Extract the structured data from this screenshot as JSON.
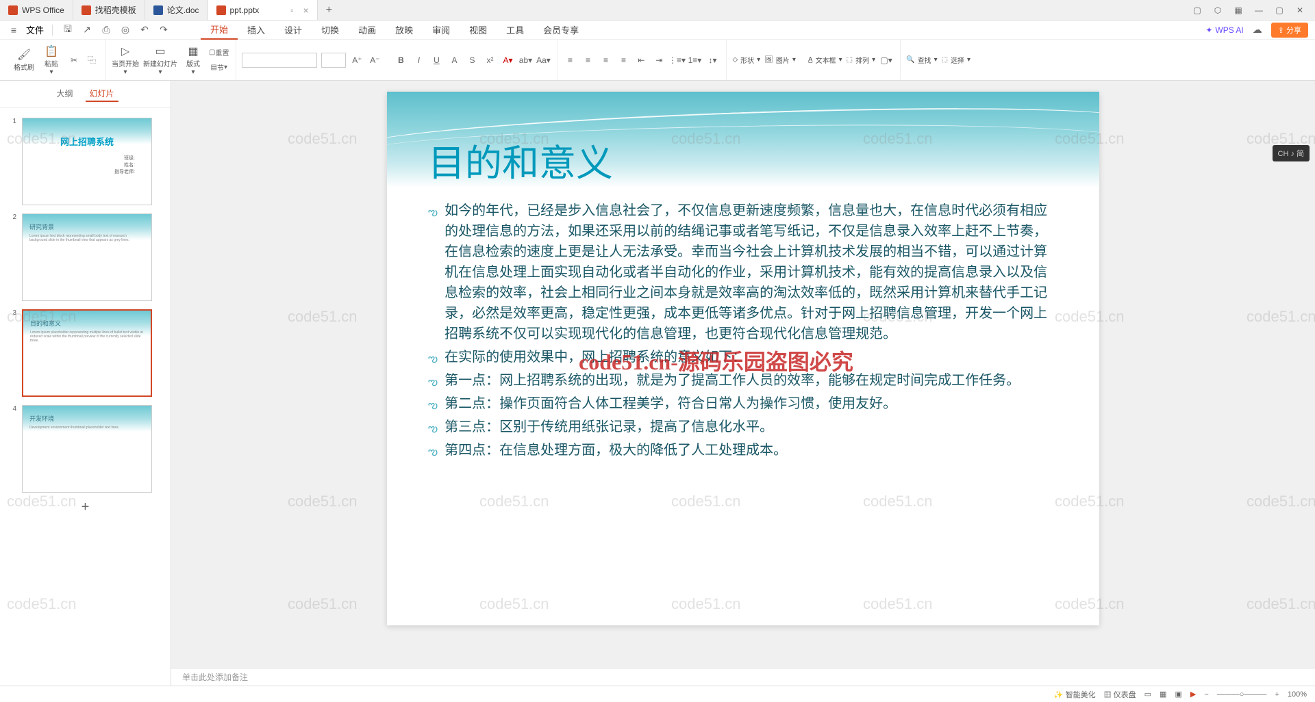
{
  "app": {
    "name": "WPS Office"
  },
  "tabs": [
    {
      "label": "WPS Office",
      "icon": "wps"
    },
    {
      "label": "找稻壳模板",
      "icon": "red"
    },
    {
      "label": "论文.doc",
      "icon": "blue"
    },
    {
      "label": "ppt.pptx",
      "icon": "orange",
      "active": true
    }
  ],
  "tab_add": "+",
  "menubar": {
    "file": "文件",
    "tabs": [
      "开始",
      "插入",
      "设计",
      "切换",
      "动画",
      "放映",
      "审阅",
      "视图",
      "工具",
      "会员专享"
    ],
    "active": "开始",
    "ai": "WPS AI",
    "share": "分享"
  },
  "ribbon": {
    "format_painter": "格式刷",
    "paste": "粘贴",
    "new_slide_start": "当页开始",
    "new_slide": "新建幻灯片",
    "layout": "版式",
    "section": "节",
    "reset": "重置",
    "shape": "形状",
    "image": "图片",
    "text_box": "文本框",
    "arrange": "排列",
    "find": "查找",
    "select": "选择"
  },
  "panel": {
    "outline_tab": "大纲",
    "slides_tab": "幻灯片",
    "thumbs": [
      {
        "num": "1",
        "title": "网上招聘系统",
        "meta": "班级:\n姓名:\n指导老师:"
      },
      {
        "num": "2",
        "title": "研究背景"
      },
      {
        "num": "3",
        "title": "目的和意义",
        "selected": true
      },
      {
        "num": "4",
        "title": "开发环境"
      }
    ],
    "add": "+"
  },
  "slide": {
    "title": "目的和意义",
    "bullets": [
      "如今的年代，已经是步入信息社会了，不仅信息更新速度频繁，信息量也大，在信息时代必须有相应的处理信息的方法，如果还采用以前的结绳记事或者笔写纸记，不仅是信息录入效率上赶不上节奏，在信息检索的速度上更是让人无法承受。幸而当今社会上计算机技术发展的相当不错，可以通过计算机在信息处理上面实现自动化或者半自动化的作业，采用计算机技术，能有效的提高信息录入以及信息检索的效率，社会上相同行业之间本身就是效率高的淘汰效率低的，既然采用计算机来替代手工记录，必然是效率更高，稳定性更强，成本更低等诸多优点。针对于网上招聘信息管理，开发一个网上招聘系统不仅可以实现现代化的信息管理，也更符合现代化信息管理规范。",
      "在实际的使用效果中，网上招聘系统的意义如下：",
      "第一点：网上招聘系统的出现，就是为了提高工作人员的效率，能够在规定时间完成工作任务。",
      "第二点：操作页面符合人体工程美学，符合日常人为操作习惯，使用友好。",
      "第三点：区别于传统用纸张记录，提高了信息化水平。",
      "第四点：在信息处理方面，极大的降低了人工处理成本。"
    ]
  },
  "notes_placeholder": "单击此处添加备注",
  "status": {
    "smart_beautify": "智能美化",
    "dashboard": "仪表盘",
    "zoom": "100%"
  },
  "ime": "CH ♪ 简",
  "watermark_text": "code51.cn",
  "watermark_red": "code51.cn-源码乐园盗图必究"
}
